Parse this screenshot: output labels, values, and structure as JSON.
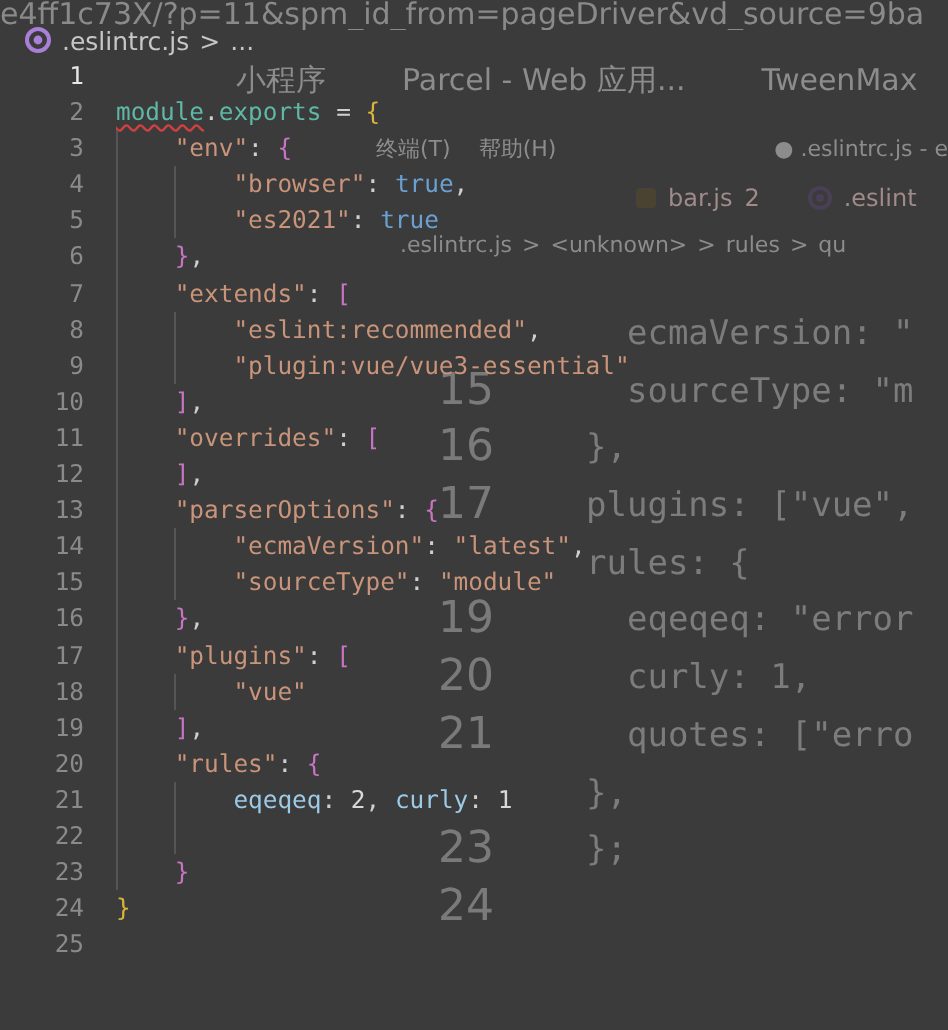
{
  "background_window": {
    "address_bar": "e4ff1c73X/?p=11&spm_id_from=pageDriver&vd_source=9ba",
    "bookmarks": [
      {
        "label": "小程序"
      },
      {
        "label": "Parcel - Web 应用..."
      },
      {
        "label": "TweenMax"
      }
    ],
    "menu": [
      "终端(T)",
      "帮助(H)"
    ],
    "title": "● .eslintrc.js - e",
    "tabs": [
      {
        "label": "bar.js",
        "problems": "2",
        "kind": "js"
      },
      {
        "label": ".eslint",
        "kind": "config"
      }
    ],
    "breadcrumb": {
      "items": [
        ".eslintrc.js",
        "<unknown>",
        "rules",
        "qu"
      ],
      "separator": ">"
    },
    "lines": [
      {
        "code": "  ecmaVersion: \""
      },
      {
        "number": "15",
        "code": "  sourceType: \"m"
      },
      {
        "number": "16",
        "code": "},"
      },
      {
        "number": "17",
        "code": "plugins: [\"vue\","
      },
      {
        "code": "rules: {"
      },
      {
        "number": "19",
        "code": "  eqeqeq: \"error"
      },
      {
        "number": "20",
        "code": "  curly: 1,"
      },
      {
        "number": "21",
        "code": "  quotes: [\"erro"
      },
      {
        "code": "},"
      },
      {
        "number": "23",
        "code": "};"
      },
      {
        "number": "24"
      }
    ]
  },
  "editor": {
    "breadcrumb": {
      "file": ".eslintrc.js",
      "separator": ">",
      "rest": "..."
    },
    "lines": [
      {
        "number": "1",
        "current": true
      },
      {
        "number": "2",
        "current": false,
        "tokens": [
          {
            "text": "module",
            "kind": "ident",
            "squiggle": true
          },
          {
            "text": ".",
            "kind": "punct"
          },
          {
            "text": "exports",
            "kind": "ident"
          },
          {
            "text": " = ",
            "kind": "punct"
          },
          {
            "text": "{",
            "kind": "bracket1"
          }
        ]
      },
      {
        "number": "3",
        "current": false,
        "tokens": [
          {
            "text": "    \"env\"",
            "kind": "string"
          },
          {
            "text": ": ",
            "kind": "punct"
          },
          {
            "text": "{",
            "kind": "bracket2"
          }
        ]
      },
      {
        "number": "4",
        "current": false,
        "tokens": [
          {
            "text": "        \"browser\"",
            "kind": "string"
          },
          {
            "text": ": ",
            "kind": "punct"
          },
          {
            "text": "true",
            "kind": "bool"
          },
          {
            "text": ",",
            "kind": "punct"
          }
        ]
      },
      {
        "number": "5",
        "current": false,
        "tokens": [
          {
            "text": "        \"es2021\"",
            "kind": "string"
          },
          {
            "text": ": ",
            "kind": "punct"
          },
          {
            "text": "true",
            "kind": "bool"
          }
        ]
      },
      {
        "number": "6",
        "current": false,
        "tokens": [
          {
            "text": "    }",
            "kind": "bracket2"
          },
          {
            "text": ",",
            "kind": "punct"
          }
        ]
      },
      {
        "number": "7",
        "current": false,
        "tokens": [
          {
            "text": "    \"extends\"",
            "kind": "string"
          },
          {
            "text": ": ",
            "kind": "punct"
          },
          {
            "text": "[",
            "kind": "bracket2"
          }
        ]
      },
      {
        "number": "8",
        "current": false,
        "tokens": [
          {
            "text": "        \"eslint:recommended\"",
            "kind": "string"
          },
          {
            "text": ",",
            "kind": "punct"
          }
        ]
      },
      {
        "number": "9",
        "current": false,
        "tokens": [
          {
            "text": "        \"plugin:vue/vue3-essential\"",
            "kind": "string"
          }
        ]
      },
      {
        "number": "10",
        "current": false,
        "tokens": [
          {
            "text": "    ]",
            "kind": "bracket2"
          },
          {
            "text": ",",
            "kind": "punct"
          }
        ]
      },
      {
        "number": "11",
        "current": false,
        "tokens": [
          {
            "text": "    \"overrides\"",
            "kind": "string"
          },
          {
            "text": ": ",
            "kind": "punct"
          },
          {
            "text": "[",
            "kind": "bracket2"
          }
        ]
      },
      {
        "number": "12",
        "current": false,
        "tokens": [
          {
            "text": "    ]",
            "kind": "bracket2"
          },
          {
            "text": ",",
            "kind": "punct"
          }
        ]
      },
      {
        "number": "13",
        "current": false,
        "tokens": [
          {
            "text": "    \"parserOptions\"",
            "kind": "string"
          },
          {
            "text": ": ",
            "kind": "punct"
          },
          {
            "text": "{",
            "kind": "bracket2"
          }
        ]
      },
      {
        "number": "14",
        "current": false,
        "tokens": [
          {
            "text": "        \"ecmaVersion\"",
            "kind": "string"
          },
          {
            "text": ": ",
            "kind": "punct"
          },
          {
            "text": "\"latest\"",
            "kind": "string"
          },
          {
            "text": ",",
            "kind": "punct"
          }
        ]
      },
      {
        "number": "15",
        "current": false,
        "tokens": [
          {
            "text": "        \"sourceType\"",
            "kind": "string"
          },
          {
            "text": ": ",
            "kind": "punct"
          },
          {
            "text": "\"module\"",
            "kind": "string"
          }
        ]
      },
      {
        "number": "16",
        "current": false,
        "tokens": [
          {
            "text": "    }",
            "kind": "bracket2"
          },
          {
            "text": ",",
            "kind": "punct"
          }
        ]
      },
      {
        "number": "17",
        "current": false,
        "tokens": [
          {
            "text": "    \"plugins\"",
            "kind": "string"
          },
          {
            "text": ": ",
            "kind": "punct"
          },
          {
            "text": "[",
            "kind": "bracket2"
          }
        ]
      },
      {
        "number": "18",
        "current": false,
        "tokens": [
          {
            "text": "        \"vue\"",
            "kind": "string"
          }
        ]
      },
      {
        "number": "19",
        "current": false,
        "tokens": [
          {
            "text": "    ]",
            "kind": "bracket2"
          },
          {
            "text": ",",
            "kind": "punct"
          }
        ]
      },
      {
        "number": "20",
        "current": false,
        "tokens": [
          {
            "text": "    \"rules\"",
            "kind": "string"
          },
          {
            "text": ": ",
            "kind": "punct"
          },
          {
            "text": "{",
            "kind": "bracket2"
          }
        ]
      },
      {
        "number": "21",
        "current": false,
        "tokens": [
          {
            "text": "        eqeqeq",
            "kind": "prop"
          },
          {
            "text": ": ",
            "kind": "punct"
          },
          {
            "text": "2",
            "kind": "number"
          },
          {
            "text": ", ",
            "kind": "punct"
          },
          {
            "text": "curly",
            "kind": "prop"
          },
          {
            "text": ": ",
            "kind": "punct"
          },
          {
            "text": "1",
            "kind": "number"
          }
        ]
      },
      {
        "number": "22",
        "current": false
      },
      {
        "number": "23",
        "current": false,
        "tokens": [
          {
            "text": "    }",
            "kind": "bracket2"
          }
        ]
      },
      {
        "number": "24",
        "current": false,
        "tokens": [
          {
            "text": "}",
            "kind": "bracket1"
          }
        ]
      },
      {
        "number": "25",
        "current": false
      }
    ]
  }
}
